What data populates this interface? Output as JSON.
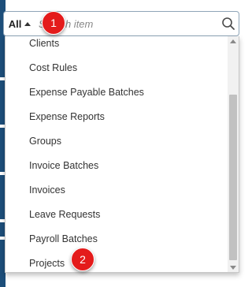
{
  "search": {
    "filter_label": "All",
    "placeholder": "Search item"
  },
  "menu": {
    "items": [
      {
        "label": "Clients"
      },
      {
        "label": "Cost Rules"
      },
      {
        "label": "Expense Payable Batches"
      },
      {
        "label": "Expense Reports"
      },
      {
        "label": "Groups"
      },
      {
        "label": "Invoice Batches"
      },
      {
        "label": "Invoices"
      },
      {
        "label": "Leave Requests"
      },
      {
        "label": "Payroll Batches"
      },
      {
        "label": "Projects"
      }
    ]
  },
  "badges": {
    "step1": "1",
    "step2": "2"
  },
  "colors": {
    "badge": "#e41b1b",
    "app_background": "#1d4e7a",
    "scroll_thumb": "#c1c1c1"
  },
  "icons": {
    "filter_caret": "caret-up-icon",
    "search": "search-icon"
  }
}
